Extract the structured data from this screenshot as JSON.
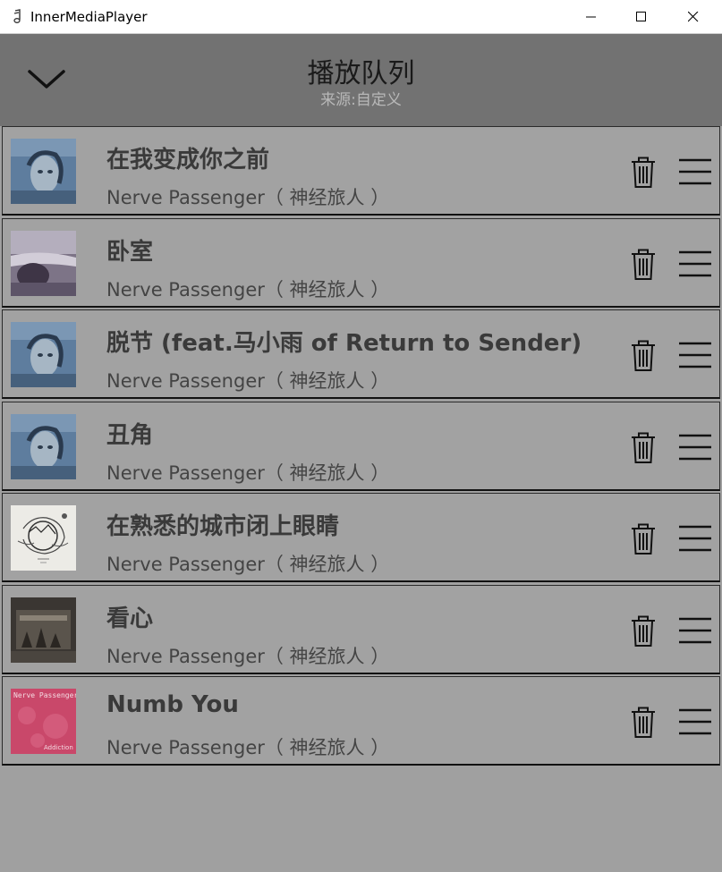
{
  "window": {
    "title": "InnerMediaPlayer"
  },
  "header": {
    "title": "播放队列",
    "subtitle": "来源:自定义"
  },
  "colors": {
    "header_bg": "#727272",
    "list_bg": "#a2a2a2",
    "page_bg": "#a0a0a0"
  },
  "queue": [
    {
      "title": "在我变成你之前",
      "artist": "Nerve Passenger（ 神经旅人 ）",
      "cover": "portrait-blue"
    },
    {
      "title": "卧室",
      "artist": "Nerve Passenger（ 神经旅人 ）",
      "cover": "blurry-sea"
    },
    {
      "title": "脱节 (feat.马小雨 of Return to Sender)",
      "artist": "Nerve Passenger（ 神经旅人 ）",
      "cover": "portrait-blue"
    },
    {
      "title": "丑角",
      "artist": "Nerve Passenger（ 神经旅人 ）",
      "cover": "portrait-blue"
    },
    {
      "title": "在熟悉的城市闭上眼睛",
      "artist": "Nerve Passenger（ 神经旅人 ）",
      "cover": "sketch-white"
    },
    {
      "title": "看心",
      "artist": "Nerve Passenger（ 神经旅人 ）",
      "cover": "dark-room"
    },
    {
      "title": "Numb You",
      "artist": "Nerve Passenger（ 神经旅人 ）",
      "cover": "pink-addiction",
      "cover_text": [
        "Nerve Passenger",
        "Addiction"
      ]
    }
  ]
}
